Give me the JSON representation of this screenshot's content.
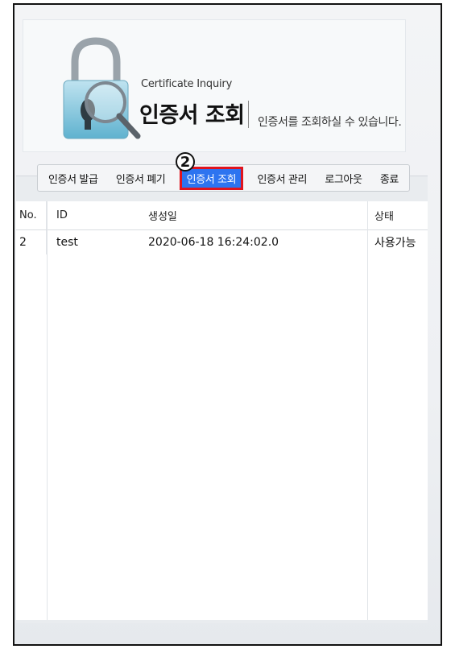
{
  "header": {
    "subtitle": "Certificate Inquiry",
    "title": "인증서 조회",
    "description": "인증서를 조회하실 수 있습니다."
  },
  "tabs": [
    {
      "label": "인증서 발급"
    },
    {
      "label": "인증서 폐기"
    },
    {
      "label": "인증서 조회",
      "active": true
    },
    {
      "label": "인증서 관리"
    },
    {
      "label": "로그아웃"
    },
    {
      "label": "종료"
    }
  ],
  "step_badge": "2",
  "table": {
    "columns": [
      "No.",
      "ID",
      "생성일",
      "상태"
    ],
    "rows": [
      {
        "no": "2",
        "id": "test",
        "created": "2020-06-18 16:24:02.0",
        "status": "사용가능"
      }
    ]
  },
  "colors": {
    "active_tab": "#2d74f0",
    "highlight_border": "#e0141e"
  }
}
